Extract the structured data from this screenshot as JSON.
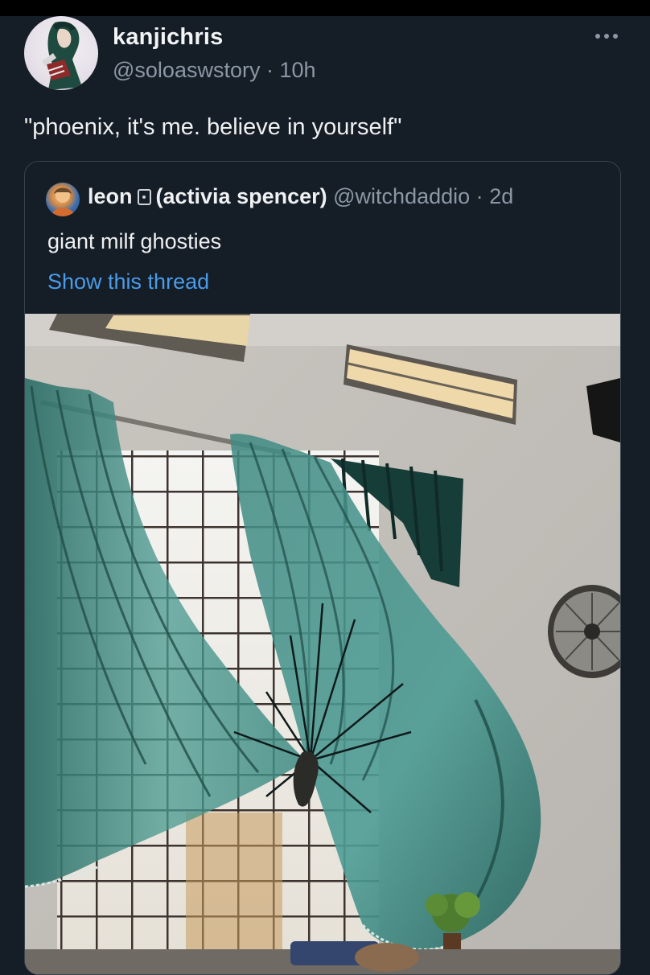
{
  "tweet": {
    "author_name": "kanjichris",
    "handle": "@soloaswstory",
    "separator": "·",
    "time": "10h",
    "text": "\"phoenix, it's me. believe in yourself\"",
    "more_icon": "more-horizontal-icon"
  },
  "quoted_tweet": {
    "author_name": "leon",
    "display_suffix": "(activia spencer)",
    "badge_icon": "card-emoji-icon",
    "handle": "@witchdaddio",
    "separator": "·",
    "time": "2d",
    "text": "giant milf ghosties",
    "show_thread_label": "Show this thread"
  },
  "colors": {
    "background": "#151d27",
    "secondary_text": "#8b98a5",
    "link": "#4a9ce8",
    "curtain": "#3f8a82"
  }
}
